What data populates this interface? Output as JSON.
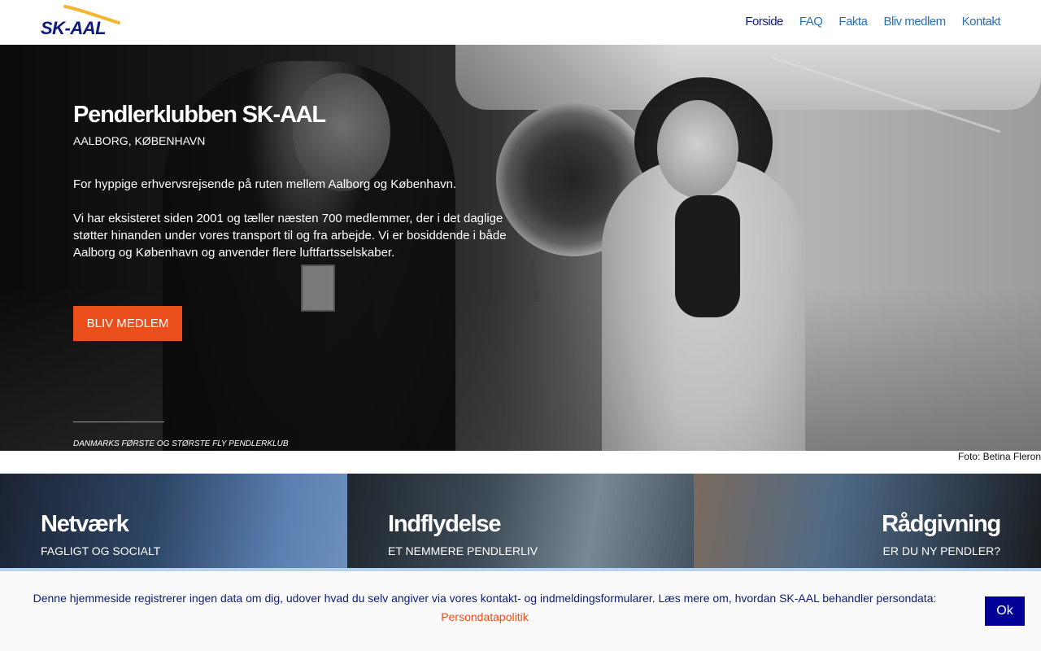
{
  "header": {
    "logo_text": "SK-AAL",
    "nav": [
      {
        "label": "Forside",
        "active": true
      },
      {
        "label": "FAQ",
        "active": false
      },
      {
        "label": "Fakta",
        "active": false
      },
      {
        "label": "Bliv medlem",
        "active": false
      },
      {
        "label": "Kontakt",
        "active": false
      }
    ]
  },
  "hero": {
    "title": "Pendlerklubben SK-AAL",
    "subtitle": "Aalborg, København",
    "paragraph1": "For hyppige erhvervsrejsende på ruten mellem Aalborg og København.",
    "paragraph2": "Vi har eksisteret siden 2001 og tæller næsten 700 medlemmer, der i det daglige støtter hinanden under vores transport til og fra arbejde. Vi er bosiddende i både Aalborg og København og anvender flere luftfartsselskaber.",
    "cta_label": "Bliv medlem",
    "tagline": "Danmarks første og største fly pendlerklub",
    "photo_credit": "Foto: Betina Fleron"
  },
  "features": [
    {
      "title": "Netværk",
      "subtitle": "Fagligt og socialt"
    },
    {
      "title": "Indflydelse",
      "subtitle": "Et nemmere pendlerliv"
    },
    {
      "title": "Rådgivning",
      "subtitle": "Er du ny pendler?"
    }
  ],
  "cookie": {
    "text": "Denne hjemmeside registrerer ingen data om dig, udover hvad du selv angiver via vores kontakt- og indmeldingsformularer. Læs mere om, hvordan SK-AAL behandler persondata:",
    "link_label": "Persondatapolitik",
    "ok_label": "Ok"
  },
  "colors": {
    "brand_navy": "#0d1a7a",
    "nav_link": "#2a6fb5",
    "accent_orange": "#e94e1b",
    "button_blue": "#000099",
    "logo_swoosh": "#f2b630"
  }
}
